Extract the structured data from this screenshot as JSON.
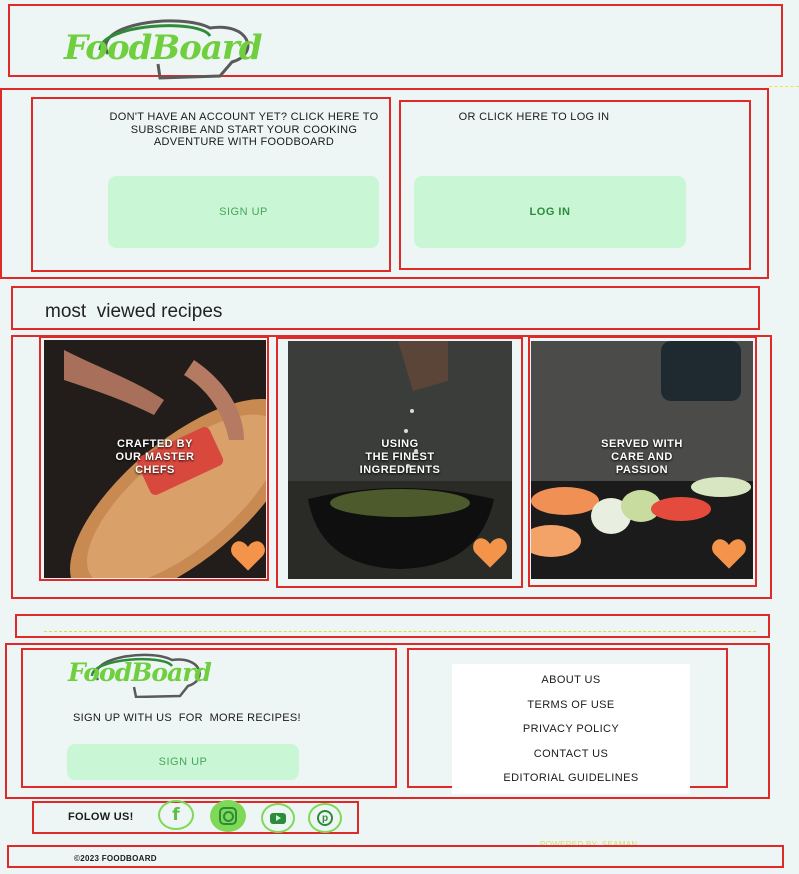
{
  "header": {
    "logo_text": "FoodBoard"
  },
  "auth": {
    "subscribe_text": "DON'T HAVE AN ACCOUNT YET? CLICK HERE TO SUBSCRIBE AND START YOUR COOKING ADVENTURE WITH FOODBOARD",
    "signup_label": "SIGN UP",
    "login_text": "OR CLICK HERE TO LOG IN",
    "login_label": "LOG IN"
  },
  "recipes": {
    "heading": "most  viewed recipes",
    "cards": [
      {
        "caption": "CRAFTED BY\nOUR MASTER\nCHEFS"
      },
      {
        "caption": "USING\nTHE FINEST\nINGREDIENTS"
      },
      {
        "caption": "SERVED WITH\nCARE AND\nPASSION"
      }
    ]
  },
  "footer": {
    "logo_text": "FoodBoard",
    "tagline": "SIGN UP WITH US  FOR  MORE RECIPES!",
    "signup_label": "SIGN UP",
    "links": [
      "ABOUT US",
      "TERMS OF USE",
      "PRIVACY POLICY",
      "CONTACT US",
      "EDITORIAL GUIDELINES"
    ],
    "follow_label": "FOLOW US!",
    "powered_by": "POWERED BY: SEAMAN",
    "copyright": "©2023 FOODBOARD"
  },
  "social_icons": [
    "facebook-icon",
    "instagram-icon",
    "youtube-icon",
    "pinterest-icon"
  ],
  "colors": {
    "background": "#eef6f5",
    "button_bg": "#c9f7d6",
    "button_text": "#4aa55a",
    "logo_green": "#6fcf3f",
    "heart": "#f4934a",
    "outline_red": "#e02a2a"
  }
}
